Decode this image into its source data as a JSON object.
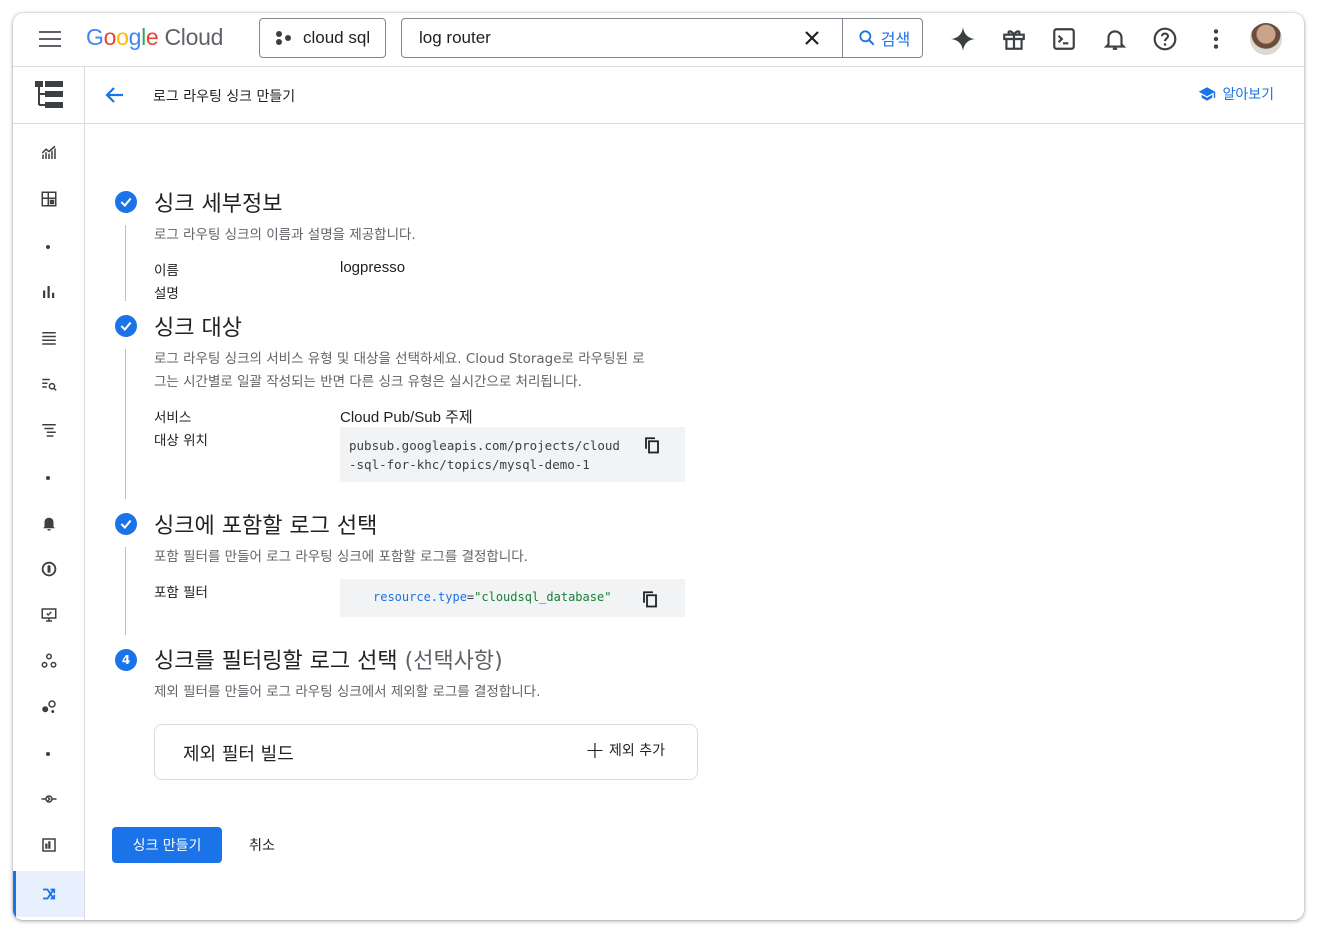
{
  "header": {
    "logo": {
      "g1": "G",
      "o1": "o",
      "o2": "o",
      "g2": "g",
      "l": "l",
      "e": "e",
      "cloud": " Cloud"
    },
    "project": "cloud sql",
    "search": {
      "value": "log router",
      "button_label": "검색"
    }
  },
  "page": {
    "title": "로그 라우팅 싱크 만들기",
    "learn_label": "알아보기"
  },
  "steps": [
    {
      "title": "싱크 세부정보",
      "description": "로그 라우팅 싱크의 이름과 설명을 제공합니다.",
      "fields": [
        {
          "label": "이름",
          "value": "logpresso"
        },
        {
          "label": "설명",
          "value": ""
        }
      ]
    },
    {
      "title": "싱크 대상",
      "description_line1": "로그 라우팅 싱크의 서비스 유형 및 대상을 선택하세요. Cloud Storage로 라우팅된 로",
      "description_line2": "그는 시간별로 일괄 작성되는 반면 다른 싱크 유형은 실시간으로 처리됩니다.",
      "fields": [
        {
          "label": "서비스",
          "value": "Cloud Pub/Sub 주제"
        },
        {
          "label": "대상 위치",
          "value_line1": "pubsub.googleapis.com/projects/cloud",
          "value_line2": "-sql-for-khc/topics/mysql-demo-1"
        }
      ]
    },
    {
      "title": "싱크에 포함할 로그 선택",
      "description": "포함 필터를 만들어 로그 라우팅 싱크에 포함할 로그를 결정합니다.",
      "fields": [
        {
          "label": "포함 필터",
          "code_key": "resource.type",
          "code_op": "=",
          "code_val": "\"cloudsql_database\""
        }
      ]
    },
    {
      "number": "4",
      "title": "싱크를 필터링할 로그 선택",
      "title_optional": " (선택사항)",
      "description": "제외 필터를 만들어 로그 라우팅 싱크에서 제외할 로그를 결정합니다.",
      "exclusion_box_title": "제외 필터 빌드",
      "add_exclusion_label": "제외 추가"
    }
  ],
  "actions": {
    "create": "싱크 만들기",
    "cancel": "취소"
  },
  "icons": {
    "topbar": [
      "gemini-icon",
      "gift-icon",
      "cloud-shell-icon",
      "notifications-icon",
      "help-icon",
      "more-vert-icon"
    ],
    "sidenav": [
      "logging-logo-icon",
      "metrics-icon",
      "dashboard-icon",
      "bar-chart-icon",
      "logs-list-icon",
      "log-analytics-icon",
      "log-explorer-icon",
      "alerts-icon",
      "sync-icon",
      "monitor-icon",
      "services-icon",
      "groups-icon",
      "uptime-icon",
      "storage-icon",
      "log-router-icon"
    ]
  },
  "colors": {
    "accent": "#1a73e8",
    "code_key": "#1a73e8",
    "code_value": "#188038"
  }
}
